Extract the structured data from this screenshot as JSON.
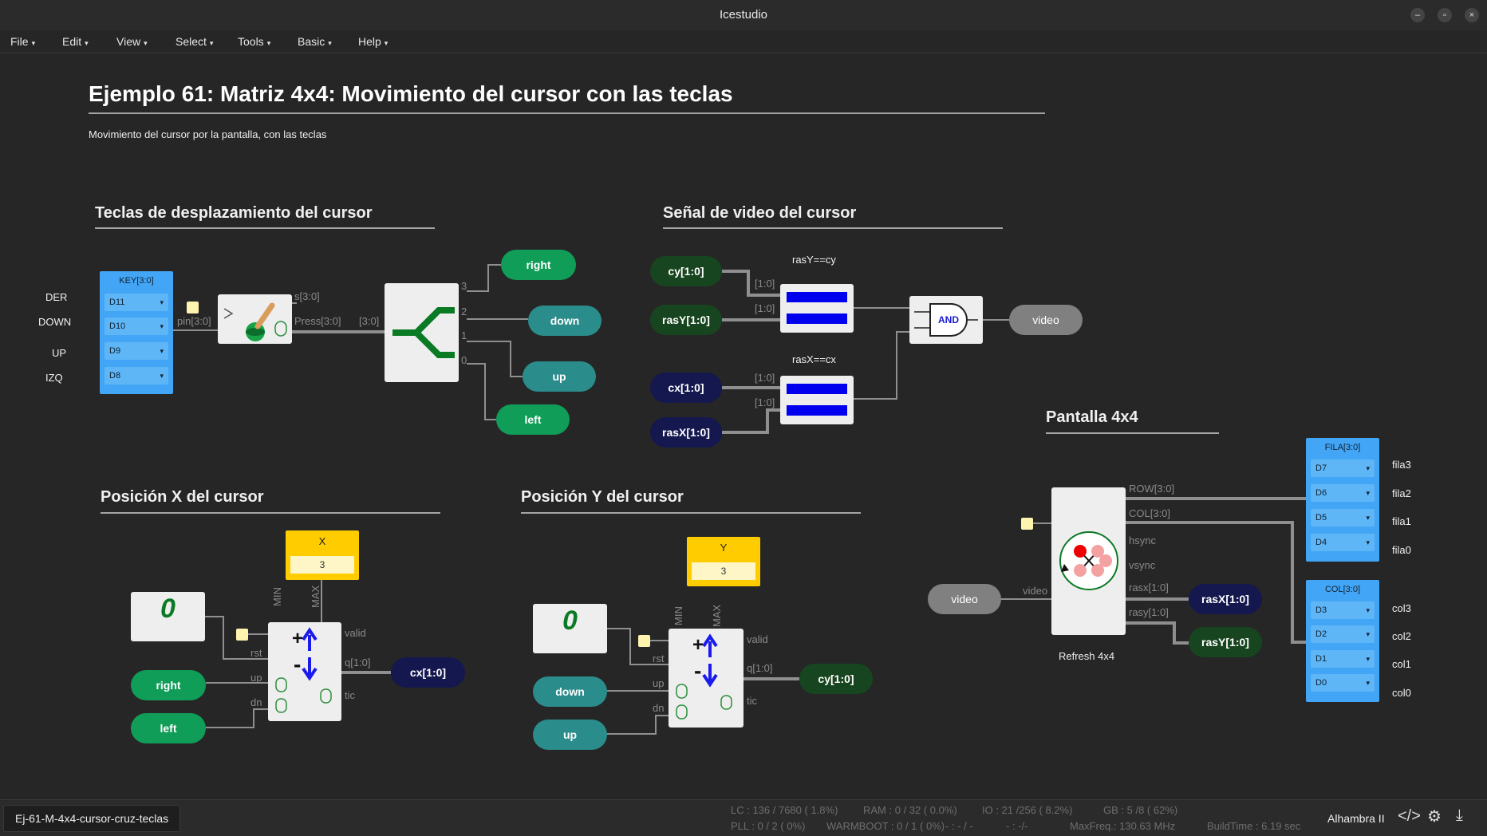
{
  "window": {
    "title": "Icestudio"
  },
  "menu": [
    "File",
    "Edit",
    "View",
    "Select",
    "Tools",
    "Basic",
    "Help"
  ],
  "header": {
    "title": "Ejemplo 61: Matriz 4x4: Movimiento del cursor con las teclas",
    "description": "Movimiento del cursor por la pantalla, con las teclas"
  },
  "sections": {
    "keys": "Teclas de desplazamiento del cursor",
    "video": "Señal de video del cursor",
    "posx": "Posición X del cursor",
    "posy": "Posición Y del cursor",
    "screen": "Pantalla 4x4"
  },
  "key_input": {
    "title": "KEY[3:0]",
    "labels": [
      "DER",
      "DOWN",
      "UP",
      "IZQ"
    ],
    "pins": [
      "D11",
      "D10",
      "D9",
      "D8"
    ]
  },
  "button_block": {
    "in": "pin[3:0]",
    "s": "s[3:0]",
    "press": "Press[3:0]"
  },
  "splitter": {
    "in": "[3:0]",
    "outs": [
      "3",
      "2",
      "1",
      "0"
    ]
  },
  "key_labels": {
    "right": "right",
    "down": "down",
    "up": "up",
    "left": "left"
  },
  "video_section": {
    "cy": "cy[1:0]",
    "rasY": "rasY[1:0]",
    "cx": "cx[1:0]",
    "rasX": "rasX[1:0]",
    "cmpY": "rasY==cy",
    "cmpX": "rasX==cx",
    "bus": "[1:0]",
    "and": "AND",
    "video": "video"
  },
  "counter_x": {
    "const_name": "X",
    "const_val": "3",
    "zero": "0",
    "min": "MIN",
    "max": "MAX",
    "rst": "rst",
    "up": "up",
    "dn": "dn",
    "valid": "valid",
    "q": "q[1:0]",
    "tic": "tic",
    "in_up": "right",
    "in_dn": "left",
    "out": "cx[1:0]"
  },
  "counter_y": {
    "const_name": "Y",
    "const_val": "3",
    "zero": "0",
    "min": "MIN",
    "max": "MAX",
    "rst": "rst",
    "up": "up",
    "dn": "dn",
    "valid": "valid",
    "q": "q[1:0]",
    "tic": "tic",
    "in_up": "down",
    "in_dn": "up",
    "out": "cy[1:0]"
  },
  "screen": {
    "in": "video",
    "in_label": "video",
    "ports": [
      "ROW[3:0]",
      "COL[3:0]",
      "hsync",
      "vsync",
      "rasx[1:0]",
      "rasy[1:0]"
    ],
    "caption": "Refresh 4x4",
    "rasX": "rasX[1:0]",
    "rasY": "rasY[1:0]"
  },
  "fila": {
    "title": "FILA[3:0]",
    "pins": [
      "D7",
      "D6",
      "D5",
      "D4"
    ],
    "labels": [
      "fila3",
      "fila2",
      "fila1",
      "fila0"
    ]
  },
  "col": {
    "title": "COL[3:0]",
    "pins": [
      "D3",
      "D2",
      "D1",
      "D0"
    ],
    "labels": [
      "col3",
      "col2",
      "col1",
      "col0"
    ]
  },
  "status": {
    "file": "Ej-61-M-4x4-cursor-cruz-teclas",
    "lc": "LC : 136 / 7680 ( 1.8%)",
    "ram": "RAM : 0 / 32 ( 0.0%)",
    "io": "IO : 21 /256 ( 8.2%)",
    "gb": "GB : 5 /8 ( 62%)",
    "pll": "PLL : 0 / 2 ( 0%)",
    "warmboot": "WARMBOOT : 0 / 1 ( 0%)",
    "dash1": "- : - / -",
    "dash2": "- : -/-",
    "maxfreq": "MaxFreq.: 130.63 MHz",
    "buildtime": "BuildTime : 6.19 sec",
    "board": "Alhambra II"
  }
}
